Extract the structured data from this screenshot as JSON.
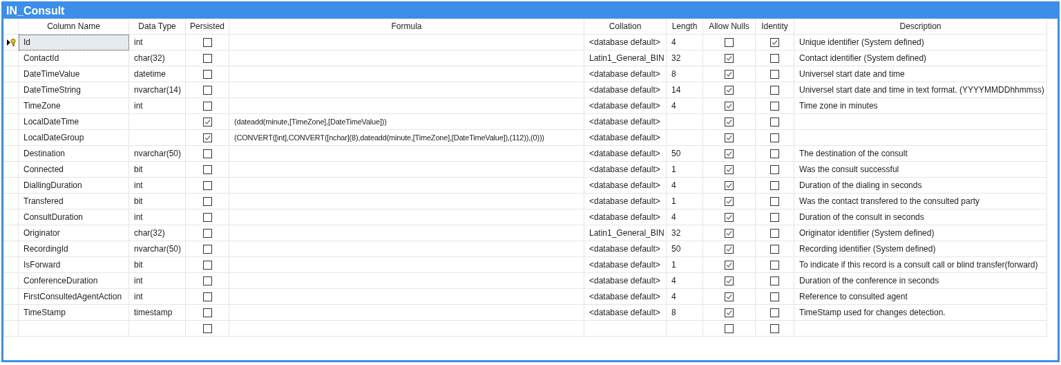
{
  "window": {
    "title": "IN_Consult"
  },
  "table": {
    "columns": [
      "Column Name",
      "Data Type",
      "Persisted",
      "Formula",
      "Collation",
      "Length",
      "Allow Nulls",
      "Identity",
      "Description"
    ],
    "rows": [
      {
        "selected": true,
        "primary_key": true,
        "name": "Id",
        "data_type": "int",
        "persisted": false,
        "collation": "<database default>",
        "length": "4",
        "allow_nulls": false,
        "identity": true,
        "description": "Unique identifier (System defined)"
      },
      {
        "selected": false,
        "primary_key": false,
        "name": "ContactId",
        "data_type": "char(32)",
        "persisted": false,
        "collation": "Latin1_General_BIN",
        "length": "32",
        "allow_nulls": true,
        "identity": false,
        "description": "Contact identifier (System defined)"
      },
      {
        "selected": false,
        "primary_key": false,
        "name": "DateTimeValue",
        "data_type": "datetime",
        "persisted": false,
        "collation": "<database default>",
        "length": "8",
        "allow_nulls": true,
        "identity": false,
        "description": "Universel start date and time"
      },
      {
        "selected": false,
        "primary_key": false,
        "name": "DateTimeString",
        "data_type": "nvarchar(14)",
        "persisted": false,
        "collation": "<database default>",
        "length": "14",
        "allow_nulls": true,
        "identity": false,
        "description": "Universel start date and time in text format. (YYYYMMDDhhmmss)"
      },
      {
        "selected": false,
        "primary_key": false,
        "name": "TimeZone",
        "data_type": "int",
        "persisted": false,
        "collation": "<database default>",
        "length": "4",
        "allow_nulls": true,
        "identity": false,
        "description": "Time zone in minutes"
      },
      {
        "selected": false,
        "primary_key": false,
        "name": "LocalDateTime",
        "persisted": true,
        "formula": "(dateadd(minute,[TimeZone],[DateTimeValue]))",
        "collation": "<database default>",
        "allow_nulls": true,
        "identity": false
      },
      {
        "selected": false,
        "primary_key": false,
        "name": "LocalDateGroup",
        "persisted": true,
        "formula": "(CONVERT([int],CONVERT([nchar](8),dateadd(minute,[TimeZone],[DateTimeValue]),(112)),(0)))",
        "collation": "<database default>",
        "allow_nulls": true,
        "identity": false
      },
      {
        "selected": false,
        "primary_key": false,
        "name": "Destination",
        "data_type": "nvarchar(50)",
        "persisted": false,
        "collation": "<database default>",
        "length": "50",
        "allow_nulls": true,
        "identity": false,
        "description": "The destination of the consult"
      },
      {
        "selected": false,
        "primary_key": false,
        "name": "Connected",
        "data_type": "bit",
        "persisted": false,
        "collation": "<database default>",
        "length": "1",
        "allow_nulls": true,
        "identity": false,
        "description": "Was the consult successful"
      },
      {
        "selected": false,
        "primary_key": false,
        "name": "DiallingDuration",
        "data_type": "int",
        "persisted": false,
        "collation": "<database default>",
        "length": "4",
        "allow_nulls": true,
        "identity": false,
        "description": "Duration of the dialing in seconds"
      },
      {
        "selected": false,
        "primary_key": false,
        "name": "Transfered",
        "data_type": "bit",
        "persisted": false,
        "collation": "<database default>",
        "length": "1",
        "allow_nulls": true,
        "identity": false,
        "description": "Was the contact transfered to the consulted party"
      },
      {
        "selected": false,
        "primary_key": false,
        "name": "ConsultDuration",
        "data_type": "int",
        "persisted": false,
        "collation": "<database default>",
        "length": "4",
        "allow_nulls": true,
        "identity": false,
        "description": "Duration of the consult in seconds"
      },
      {
        "selected": false,
        "primary_key": false,
        "name": "Originator",
        "data_type": "char(32)",
        "persisted": false,
        "collation": "Latin1_General_BIN",
        "length": "32",
        "allow_nulls": true,
        "identity": false,
        "description": "Originator identifier (System defined)"
      },
      {
        "selected": false,
        "primary_key": false,
        "name": "RecordingId",
        "data_type": "nvarchar(50)",
        "persisted": false,
        "collation": "<database default>",
        "length": "50",
        "allow_nulls": true,
        "identity": false,
        "description": "Recording identifier (System defined)"
      },
      {
        "selected": false,
        "primary_key": false,
        "name": "IsForward",
        "data_type": "bit",
        "persisted": false,
        "collation": "<database default>",
        "length": "1",
        "allow_nulls": true,
        "identity": false,
        "description": "To indicate if this record is a consult call or blind transfer(forward)"
      },
      {
        "selected": false,
        "primary_key": false,
        "name": "ConferenceDuration",
        "data_type": "int",
        "persisted": false,
        "collation": "<database default>",
        "length": "4",
        "allow_nulls": true,
        "identity": false,
        "description": "Duration of the conference in seconds"
      },
      {
        "selected": false,
        "primary_key": false,
        "name": "FirstConsultedAgentAction",
        "data_type": "int",
        "persisted": false,
        "collation": "<database default>",
        "length": "4",
        "allow_nulls": true,
        "identity": false,
        "description": "Reference to consulted agent"
      },
      {
        "selected": false,
        "primary_key": false,
        "name": "TimeStamp",
        "data_type": "timestamp",
        "persisted": false,
        "collation": "<database default>",
        "length": "8",
        "allow_nulls": true,
        "identity": false,
        "description": "TimeStamp used for changes detection."
      },
      {
        "selected": false,
        "primary_key": false,
        "persisted": false,
        "allow_nulls": false,
        "identity": false
      }
    ]
  }
}
